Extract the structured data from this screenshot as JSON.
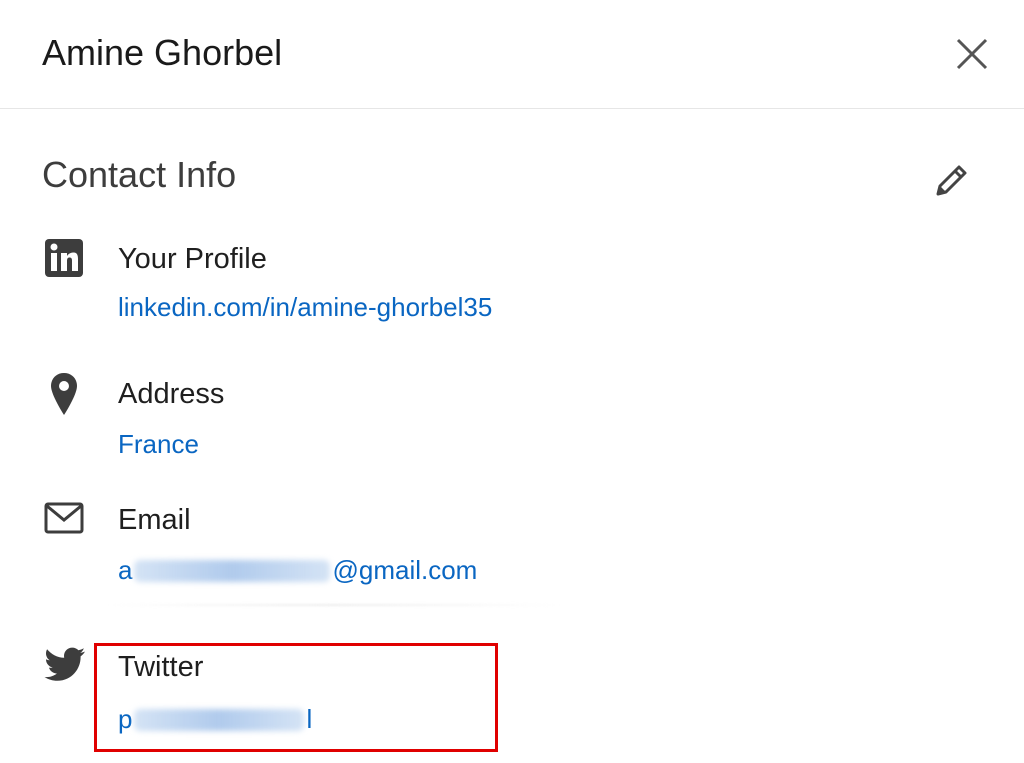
{
  "header": {
    "title": "Amine Ghorbel",
    "close_icon": "close-icon"
  },
  "section": {
    "title": "Contact Info",
    "edit_icon": "pencil-icon"
  },
  "items": [
    {
      "icon": "linkedin-icon",
      "label": "Your Profile",
      "value": "linkedin.com/in/amine-ghorbel35"
    },
    {
      "icon": "location-pin-icon",
      "label": "Address",
      "value": "France"
    },
    {
      "icon": "mail-icon",
      "label": "Email",
      "value_prefix": "a",
      "value_suffix": "@gmail.com"
    },
    {
      "icon": "twitter-icon",
      "label": "Twitter",
      "value_prefix": "p",
      "value_suffix": "l"
    }
  ],
  "colors": {
    "link": "#0a66c2",
    "highlight_border": "#e00000",
    "icon": "#3d3d3d"
  }
}
